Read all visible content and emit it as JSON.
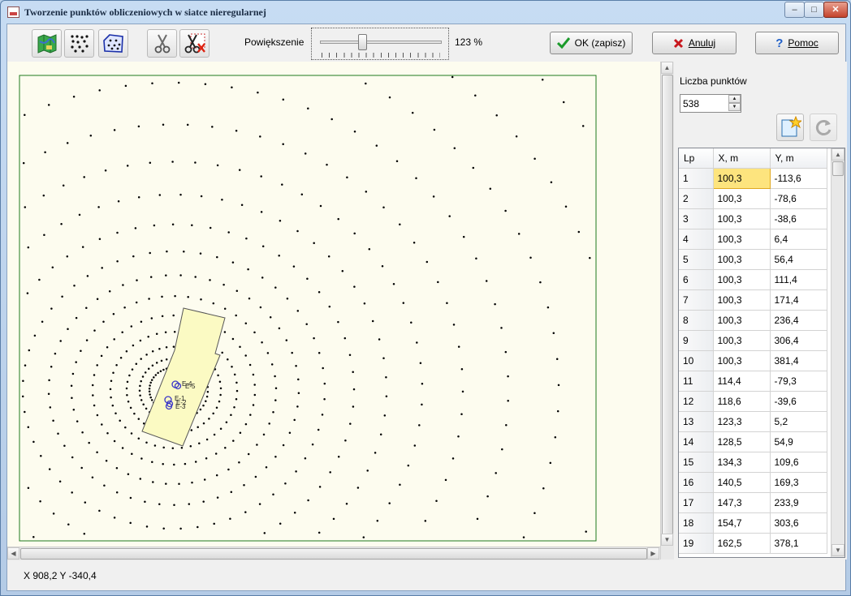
{
  "window": {
    "title": "Tworzenie punktów obliczeniowych w siatce nieregularnej",
    "controls": [
      "–",
      "□",
      "✕"
    ]
  },
  "toolbar": {
    "zoom_label": "Powiększenie",
    "zoom_value": "123 %",
    "zoom_level": 123,
    "ok_label": "OK (zapisz)",
    "cancel_label": "Anuluj",
    "help_label": "Pomoc",
    "tools": [
      "map-icon",
      "point-grid-icon",
      "polygon-points-icon",
      "scissors-icon",
      "scissors-delete-icon"
    ]
  },
  "map": {
    "point_labels": [
      "E-4",
      "E-5",
      "E-1",
      "E-2",
      "E-3"
    ],
    "colors": {
      "background": "#fdfcef",
      "border": "#1e7a1e",
      "building": "#fbfac3",
      "points": "#000000",
      "emitters": "#3a36c8"
    }
  },
  "side": {
    "count_label": "Liczba punktów",
    "count_value": "538",
    "table": {
      "headers": [
        "Lp",
        "X, m",
        "Y, m"
      ],
      "selected_row": 0,
      "rows": [
        [
          "1",
          "100,3",
          "-113,6"
        ],
        [
          "2",
          "100,3",
          "-78,6"
        ],
        [
          "3",
          "100,3",
          "-38,6"
        ],
        [
          "4",
          "100,3",
          "6,4"
        ],
        [
          "5",
          "100,3",
          "56,4"
        ],
        [
          "6",
          "100,3",
          "111,4"
        ],
        [
          "7",
          "100,3",
          "171,4"
        ],
        [
          "8",
          "100,3",
          "236,4"
        ],
        [
          "9",
          "100,3",
          "306,4"
        ],
        [
          "10",
          "100,3",
          "381,4"
        ],
        [
          "11",
          "114,4",
          "-79,3"
        ],
        [
          "12",
          "118,6",
          "-39,6"
        ],
        [
          "13",
          "123,3",
          "5,2"
        ],
        [
          "14",
          "128,5",
          "54,9"
        ],
        [
          "15",
          "134,3",
          "109,6"
        ],
        [
          "16",
          "140,5",
          "169,3"
        ],
        [
          "17",
          "147,3",
          "233,9"
        ],
        [
          "18",
          "154,7",
          "303,6"
        ],
        [
          "19",
          "162,5",
          "378,1"
        ]
      ]
    }
  },
  "status": {
    "coords": "X 908,2 Y -340,4"
  }
}
